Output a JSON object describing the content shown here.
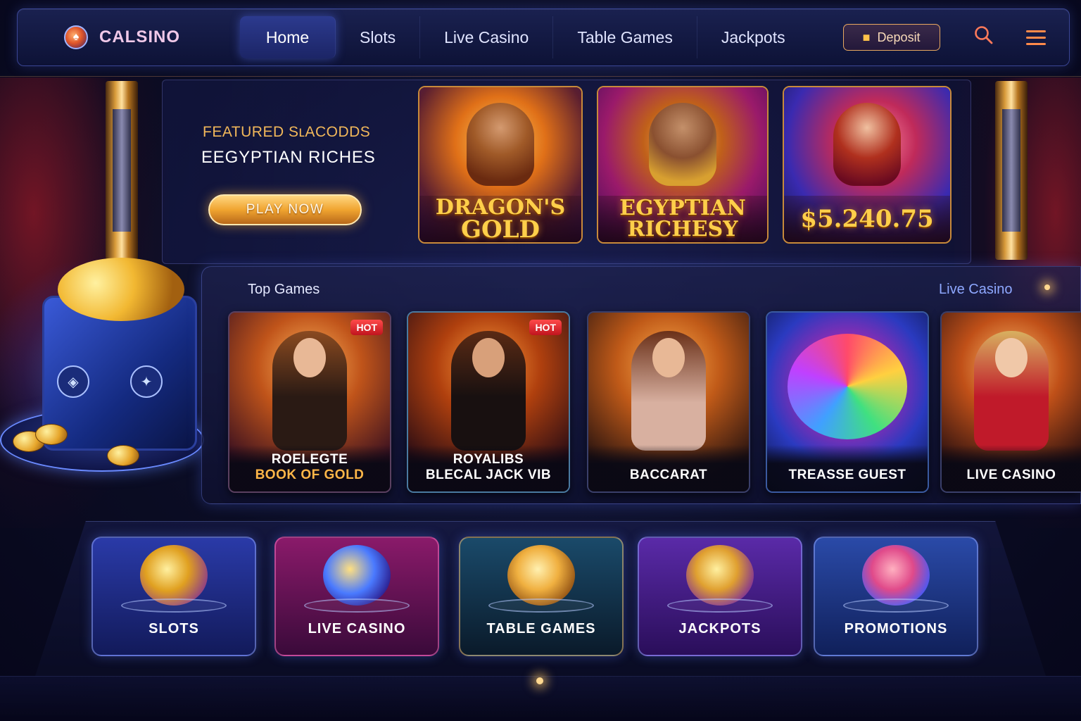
{
  "nav": {
    "logo_text": "CALSINO",
    "items": [
      {
        "label": "Home",
        "active": true
      },
      {
        "label": "Slots"
      },
      {
        "label": "Live Casino"
      },
      {
        "label": "Table Games"
      },
      {
        "label": "Jackpots"
      }
    ],
    "deposit_label": "Deposit",
    "icons": {
      "logo": "casino-logo-icon",
      "deposit": "gift-icon",
      "search": "search-icon",
      "menu": "hamburger-menu-icon"
    }
  },
  "hero": {
    "featured_label": "FEATURED SʟACODDS",
    "featured_title": "EEGYPTIAN RICHES",
    "play_button": "PLAY NOW",
    "cards": [
      {
        "title_line1": "DRAGON'S",
        "title_line2": "GOLD"
      },
      {
        "title_line1": "EGYPTIAN",
        "title_line2": "RICHESY"
      },
      {
        "title_line1": "$5.240.75",
        "title_line2": ""
      }
    ]
  },
  "top_games": {
    "title": "Top Games",
    "link": "Live Casino",
    "cards": [
      {
        "line1": "ROELEGTE",
        "line2": "BOOK OF GOLD",
        "badge": "HOT"
      },
      {
        "line1": "ROYALIBS",
        "line2": "BLECAL JACK VIB",
        "badge": "HOT"
      },
      {
        "line1": "BACCARAT",
        "line2": "",
        "badge": ""
      },
      {
        "line1": "TREASSE GUEST",
        "line2": "",
        "badge": ""
      },
      {
        "line1": "LIVE CASINO",
        "line2": "",
        "badge": ""
      }
    ]
  },
  "categories": [
    {
      "label": "SLOTS",
      "icon": "slots-icon"
    },
    {
      "label": "LIVE CASINO",
      "icon": "live-casino-icon"
    },
    {
      "label": "TABLE GAMES",
      "icon": "table-games-icon"
    },
    {
      "label": "JACKPOTS",
      "icon": "jackpots-icon"
    },
    {
      "label": "PROMOTIONS",
      "icon": "promotions-icon"
    }
  ],
  "colors": {
    "accent_gold": "#f2b85a",
    "hot_red": "#e0202a",
    "nav_bg": "#1a2150"
  }
}
